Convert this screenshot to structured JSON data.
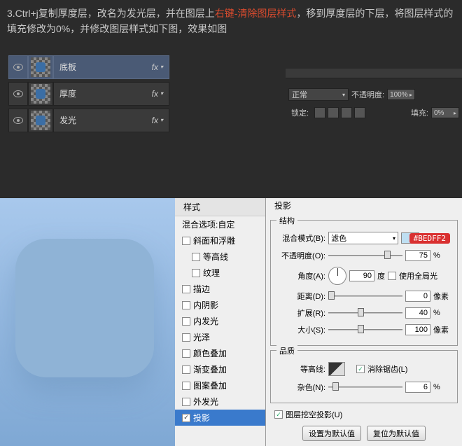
{
  "instruction": {
    "step": "3.Ctrl+j复制厚度层，改名为发光层，并在图层上",
    "red": "右键-清除图层样式",
    "after": "，移到厚度层的下层，将图层样式的填充修改为0%，并修改图层样式如下图，效果如图"
  },
  "layers": [
    {
      "name": "底板",
      "fx": "fx"
    },
    {
      "name": "厚度",
      "fx": "fx"
    },
    {
      "name": "发光",
      "fx": "fx"
    }
  ],
  "blend_panel": {
    "mode": "正常",
    "opacity_label": "不透明度:",
    "opacity": "100%",
    "lock_label": "锁定:",
    "fill_label": "填充:",
    "fill": "0%"
  },
  "styles_list": {
    "header": "样式",
    "blend_opts": "混合选项:自定",
    "items": [
      {
        "label": "斜面和浮雕",
        "checked": false,
        "indent": false
      },
      {
        "label": "等高线",
        "checked": false,
        "indent": true
      },
      {
        "label": "纹理",
        "checked": false,
        "indent": true
      },
      {
        "label": "描边",
        "checked": false,
        "indent": false
      },
      {
        "label": "内阴影",
        "checked": false,
        "indent": false
      },
      {
        "label": "内发光",
        "checked": false,
        "indent": false
      },
      {
        "label": "光泽",
        "checked": false,
        "indent": false
      },
      {
        "label": "颜色叠加",
        "checked": false,
        "indent": false
      },
      {
        "label": "渐变叠加",
        "checked": false,
        "indent": false
      },
      {
        "label": "图案叠加",
        "checked": false,
        "indent": false
      },
      {
        "label": "外发光",
        "checked": false,
        "indent": false
      },
      {
        "label": "投影",
        "checked": true,
        "indent": false,
        "selected": true
      }
    ]
  },
  "shadow": {
    "title": "投影",
    "struct": "结构",
    "hex": "#BEDFF2",
    "blend_mode_label": "混合模式(B):",
    "blend_mode": "滤色",
    "opacity_label": "不透明度(O):",
    "opacity": "75",
    "angle_label": "角度(A):",
    "angle": "90",
    "angle_unit": "度",
    "global_light": "使用全局光",
    "distance_label": "距离(D):",
    "distance": "0",
    "distance_unit": "像素",
    "spread_label": "扩展(R):",
    "spread": "40",
    "spread_unit": "%",
    "size_label": "大小(S):",
    "size": "100",
    "size_unit": "像素",
    "quality": "品质",
    "contour_label": "等高线:",
    "antialias": "消除锯齿(L)",
    "noise_label": "杂色(N):",
    "noise": "6",
    "noise_unit": "%",
    "knockout": "图层挖空投影(U)",
    "btn_default": "设置为默认值",
    "btn_reset": "复位为默认值"
  }
}
